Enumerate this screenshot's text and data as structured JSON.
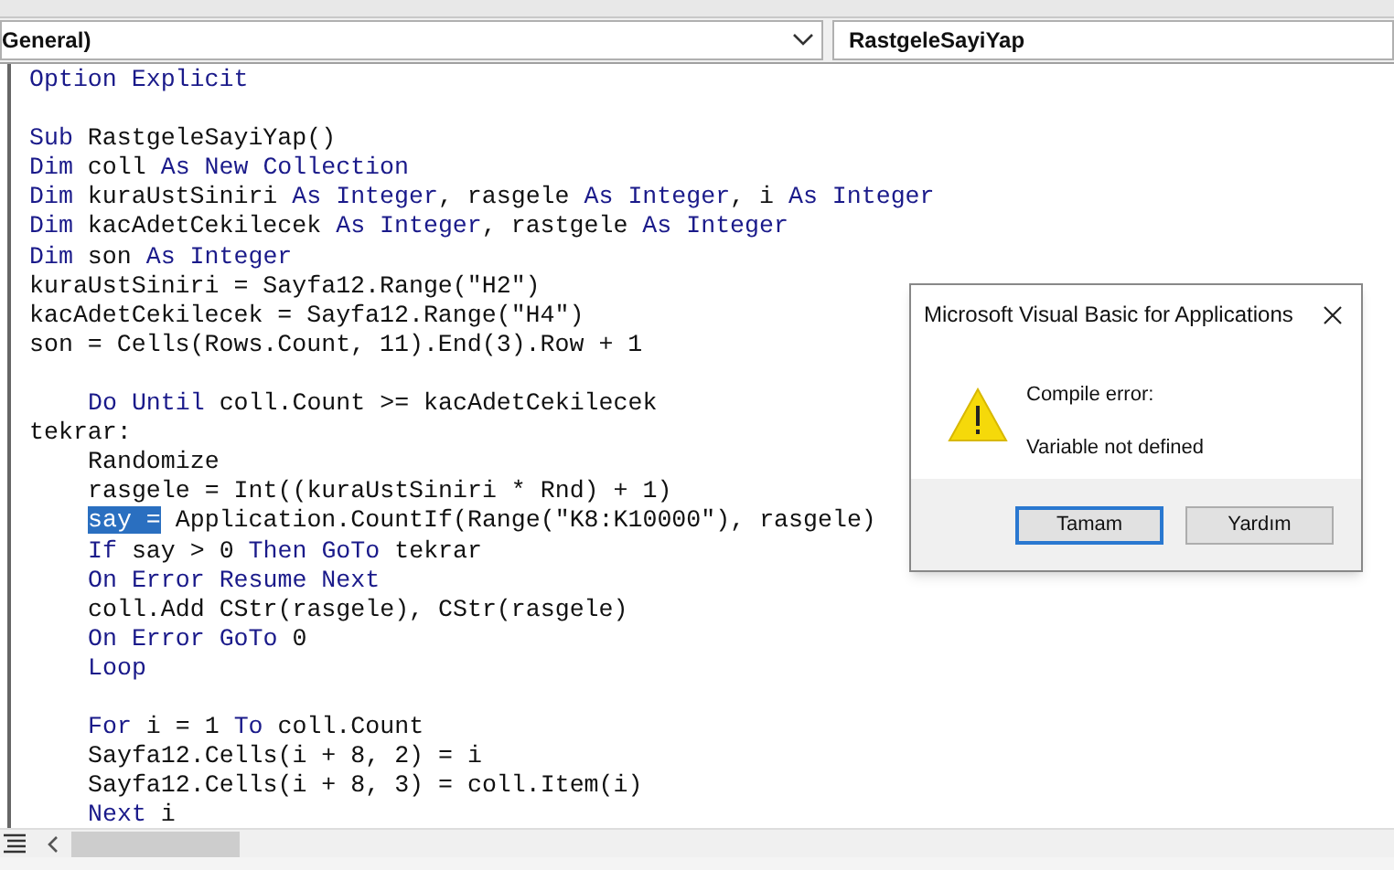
{
  "toolbar": {
    "object_box": {
      "value": "General)"
    },
    "procedure_box": {
      "value": "RastgeleSayiYap"
    }
  },
  "code_lines": [
    {
      "kind": "code",
      "indented": false,
      "segments": [
        {
          "kind": "keyword",
          "text": "Option Explicit"
        }
      ]
    },
    {
      "kind": "blank"
    },
    {
      "kind": "code",
      "indented": false,
      "segments": [
        {
          "kind": "keyword",
          "text": "Sub"
        },
        {
          "kind": "plain",
          "text": " RastgeleSayiYap()"
        }
      ]
    },
    {
      "kind": "code",
      "indented": false,
      "segments": [
        {
          "kind": "keyword",
          "text": "Dim"
        },
        {
          "kind": "plain",
          "text": " coll "
        },
        {
          "kind": "keyword",
          "text": "As New Collection"
        }
      ]
    },
    {
      "kind": "code",
      "indented": false,
      "segments": [
        {
          "kind": "keyword",
          "text": "Dim"
        },
        {
          "kind": "plain",
          "text": " kuraUstSiniri "
        },
        {
          "kind": "keyword",
          "text": "As Integer"
        },
        {
          "kind": "plain",
          "text": ", rasgele "
        },
        {
          "kind": "keyword",
          "text": "As Integer"
        },
        {
          "kind": "plain",
          "text": ", i "
        },
        {
          "kind": "keyword",
          "text": "As Integer"
        }
      ]
    },
    {
      "kind": "code",
      "indented": false,
      "segments": [
        {
          "kind": "keyword",
          "text": "Dim"
        },
        {
          "kind": "plain",
          "text": " kacAdetCekilecek "
        },
        {
          "kind": "keyword",
          "text": "As Integer"
        },
        {
          "kind": "plain",
          "text": ", rastgele "
        },
        {
          "kind": "keyword",
          "text": "As Integer"
        }
      ]
    },
    {
      "kind": "code",
      "indented": false,
      "segments": [
        {
          "kind": "keyword",
          "text": "Dim"
        },
        {
          "kind": "plain",
          "text": " son "
        },
        {
          "kind": "keyword",
          "text": "As Integer"
        }
      ]
    },
    {
      "kind": "code",
      "indented": false,
      "segments": [
        {
          "kind": "plain",
          "text": "kuraUstSiniri = Sayfa12.Range(\"H2\")"
        }
      ]
    },
    {
      "kind": "code",
      "indented": false,
      "segments": [
        {
          "kind": "plain",
          "text": "kacAdetCekilecek = Sayfa12.Range(\"H4\")"
        }
      ]
    },
    {
      "kind": "code",
      "indented": false,
      "segments": [
        {
          "kind": "plain",
          "text": "son = Cells(Rows.Count, 11).End(3).Row + 1"
        }
      ]
    },
    {
      "kind": "blank"
    },
    {
      "kind": "code",
      "indented": true,
      "segments": [
        {
          "kind": "keyword",
          "text": "Do Until"
        },
        {
          "kind": "plain",
          "text": " coll.Count >= kacAdetCekilecek"
        }
      ]
    },
    {
      "kind": "code",
      "indented": false,
      "segments": [
        {
          "kind": "plain",
          "text": "tekrar:"
        }
      ]
    },
    {
      "kind": "code",
      "indented": true,
      "segments": [
        {
          "kind": "plain",
          "text": "Randomize"
        }
      ]
    },
    {
      "kind": "code",
      "indented": true,
      "segments": [
        {
          "kind": "plain",
          "text": "rasgele = Int((kuraUstSiniri * Rnd) + 1)"
        }
      ]
    },
    {
      "kind": "code",
      "indented": true,
      "segments": [
        {
          "kind": "selected",
          "text": "say ="
        },
        {
          "kind": "plain",
          "text": " Application.CountIf(Range(\"K8:K10000\"), rasgele)"
        }
      ]
    },
    {
      "kind": "code",
      "indented": true,
      "segments": [
        {
          "kind": "keyword",
          "text": "If"
        },
        {
          "kind": "plain",
          "text": " say > 0 "
        },
        {
          "kind": "keyword",
          "text": "Then GoTo"
        },
        {
          "kind": "plain",
          "text": " tekrar"
        }
      ]
    },
    {
      "kind": "code",
      "indented": true,
      "segments": [
        {
          "kind": "keyword",
          "text": "On Error Resume Next"
        }
      ]
    },
    {
      "kind": "code",
      "indented": true,
      "segments": [
        {
          "kind": "plain",
          "text": "coll.Add CStr(rasgele), CStr(rasgele)"
        }
      ]
    },
    {
      "kind": "code",
      "indented": true,
      "segments": [
        {
          "kind": "keyword",
          "text": "On Error GoTo"
        },
        {
          "kind": "plain",
          "text": " 0"
        }
      ]
    },
    {
      "kind": "code",
      "indented": true,
      "segments": [
        {
          "kind": "keyword",
          "text": "Loop"
        }
      ]
    },
    {
      "kind": "blank"
    },
    {
      "kind": "code",
      "indented": true,
      "segments": [
        {
          "kind": "keyword",
          "text": "For"
        },
        {
          "kind": "plain",
          "text": " i = 1 "
        },
        {
          "kind": "keyword",
          "text": "To"
        },
        {
          "kind": "plain",
          "text": " coll.Count"
        }
      ]
    },
    {
      "kind": "code",
      "indented": true,
      "segments": [
        {
          "kind": "plain",
          "text": "Sayfa12.Cells(i + 8, 2) = i"
        }
      ]
    },
    {
      "kind": "code",
      "indented": true,
      "segments": [
        {
          "kind": "plain",
          "text": "Sayfa12.Cells(i + 8, 3) = coll.Item(i)"
        }
      ]
    },
    {
      "kind": "code",
      "indented": true,
      "segments": [
        {
          "kind": "keyword",
          "text": "Next"
        },
        {
          "kind": "plain",
          "text": " i"
        }
      ]
    }
  ],
  "dialog": {
    "title": "Microsoft Visual Basic for Applications",
    "heading": "Compile error:",
    "message": "Variable not defined",
    "buttons": [
      {
        "label": "Tamam",
        "selected": true
      },
      {
        "label": "Yardım",
        "selected": false
      }
    ]
  }
}
